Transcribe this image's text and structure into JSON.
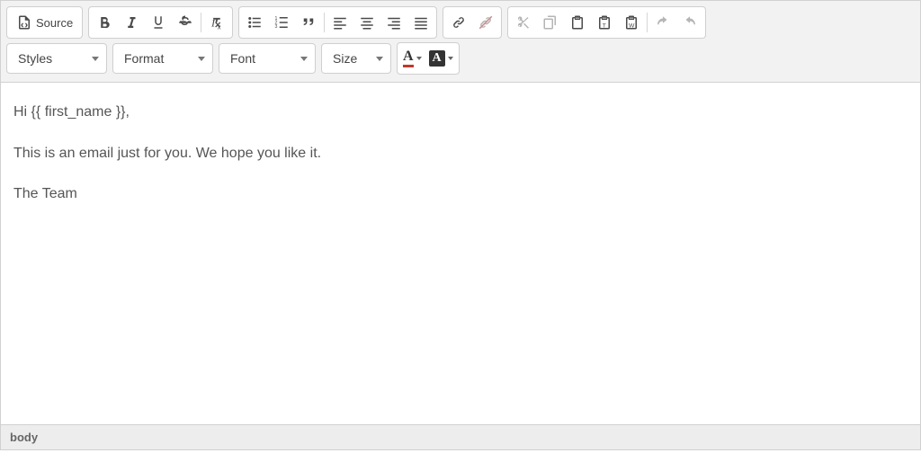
{
  "toolbar": {
    "source_label": "Source",
    "row2": {
      "styles_label": "Styles",
      "format_label": "Format",
      "font_label": "Font",
      "size_label": "Size"
    }
  },
  "content": {
    "line1": "Hi {{ first_name }},",
    "line2": "This is an email just for you. We hope you like it.",
    "line3": "The Team"
  },
  "status": {
    "path": "body"
  }
}
